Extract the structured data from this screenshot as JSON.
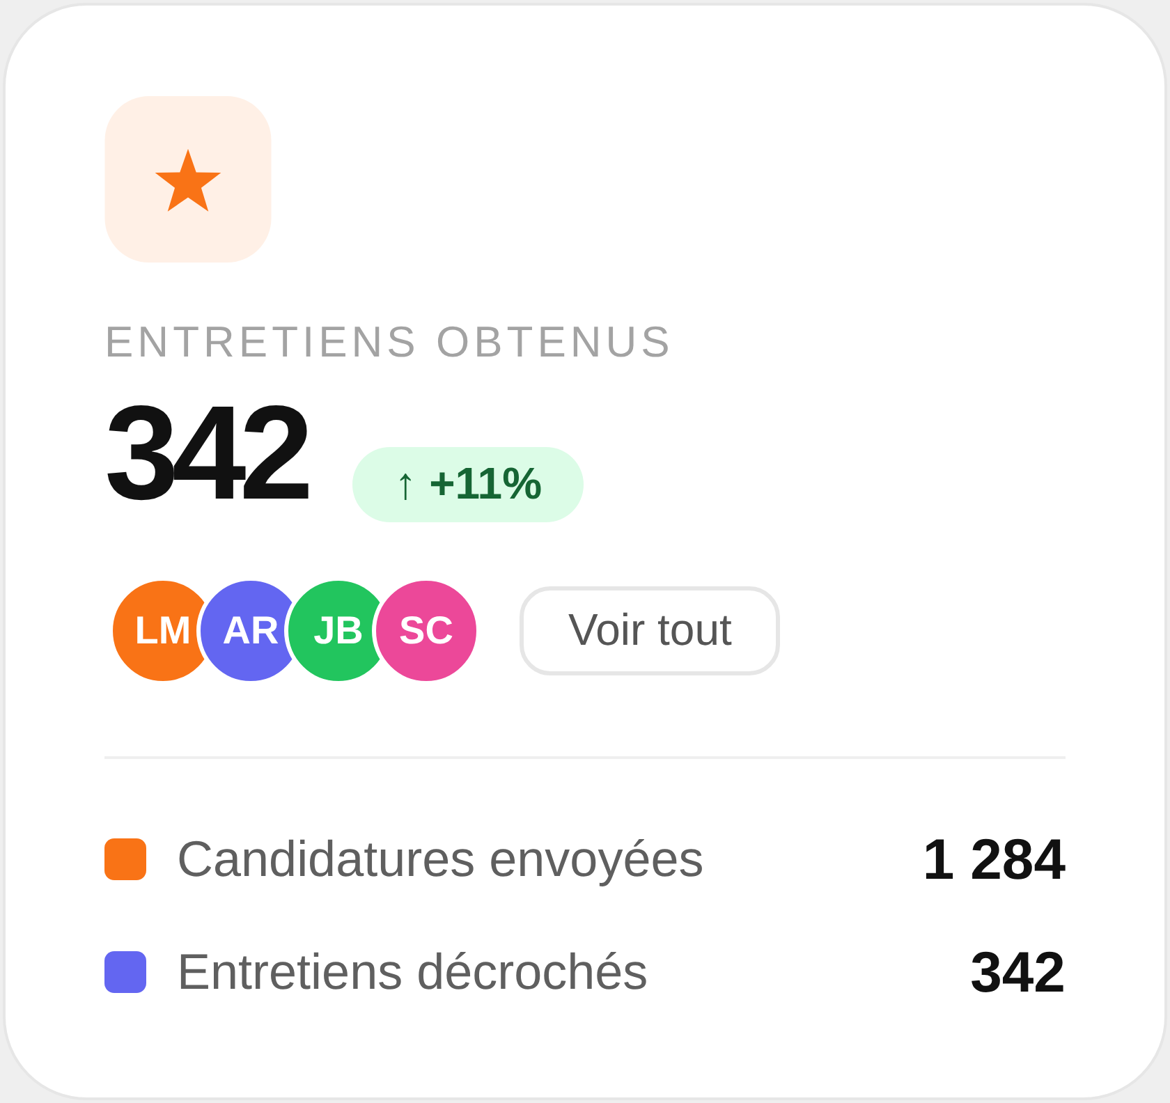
{
  "metric": {
    "label": "ENTRETIENS OBTENUS",
    "value": "342",
    "change": "↑ +11%"
  },
  "avatars": [
    {
      "initials": "LM",
      "color": "#f97316"
    },
    {
      "initials": "AR",
      "color": "#6366f1"
    },
    {
      "initials": "JB",
      "color": "#22c55e"
    },
    {
      "initials": "SC",
      "color": "#ec4899"
    }
  ],
  "view_all_button": {
    "label": "Voir tout"
  },
  "legend": [
    {
      "label": "Candidatures envoyées",
      "value": "1 284",
      "color": "#f97316"
    },
    {
      "label": "Entretiens décrochés",
      "value": "342",
      "color": "#6366f1"
    }
  ]
}
